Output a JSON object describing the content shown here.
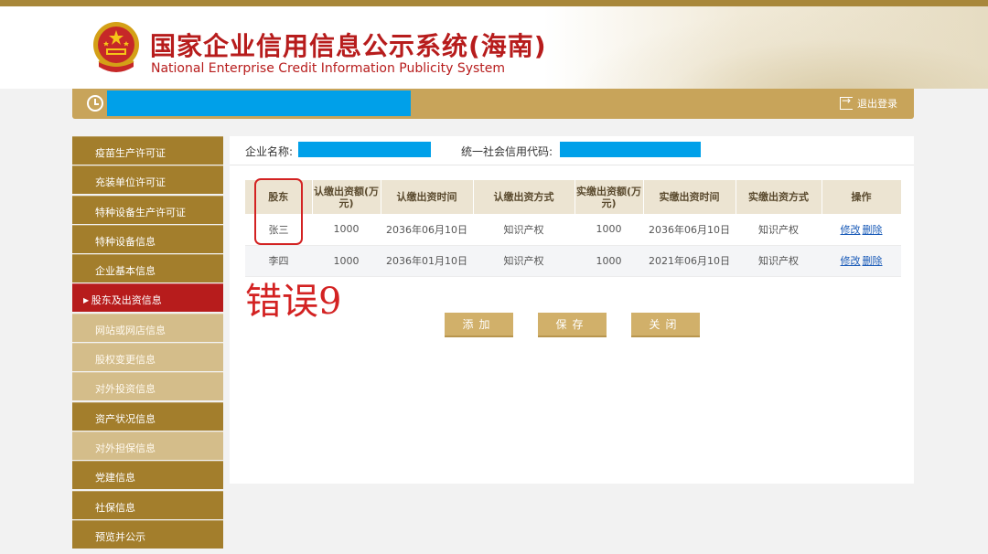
{
  "header": {
    "title_cn": "国家企业信用信息公示系统(海南)",
    "title_en": "National Enterprise Credit Information Publicity System"
  },
  "navbar": {
    "logout_label": "退出登录"
  },
  "sidebar": {
    "items": [
      {
        "label": "疫苗生产许可证",
        "style": "dark"
      },
      {
        "label": "充装单位许可证",
        "style": "dark"
      },
      {
        "label": "特种设备生产许可证",
        "style": "dark"
      },
      {
        "label": "特种设备信息",
        "style": "dark"
      },
      {
        "label": "企业基本信息",
        "style": "dark"
      },
      {
        "label": "股东及出资信息",
        "style": "active"
      },
      {
        "label": "网站或网店信息",
        "style": "light"
      },
      {
        "label": "股权变更信息",
        "style": "light"
      },
      {
        "label": "对外投资信息",
        "style": "light"
      },
      {
        "label": "资产状况信息",
        "style": "dark"
      },
      {
        "label": "对外担保信息",
        "style": "light"
      },
      {
        "label": "党建信息",
        "style": "dark"
      },
      {
        "label": "社保信息",
        "style": "dark"
      },
      {
        "label": "预览并公示",
        "style": "dark"
      }
    ]
  },
  "main": {
    "company_name_label": "企业名称:",
    "credit_code_label": "统一社会信用代码:",
    "table": {
      "headers": [
        "股东",
        "认缴出资额(万元)",
        "认缴出资时间",
        "认缴出资方式",
        "实缴出资额(万元)",
        "实缴出资时间",
        "实缴出资方式",
        "操作"
      ],
      "rows": [
        [
          "张三",
          "1000",
          "2036年06月10日",
          "知识产权",
          "1000",
          "2036年06月10日",
          "知识产权"
        ],
        [
          "李四",
          "1000",
          "2036年01月10日",
          "知识产权",
          "1000",
          "2021年06月10日",
          "知识产权"
        ]
      ],
      "edit_label": "修改",
      "delete_label": "删除"
    },
    "error_annotation": "错误9",
    "buttons": {
      "add": "添加",
      "save": "保存",
      "close": "关闭"
    }
  },
  "colors": {
    "brand_red": "#b71c1c",
    "gold": "#a37e2c",
    "redacted_blue": "#00a0e9"
  }
}
